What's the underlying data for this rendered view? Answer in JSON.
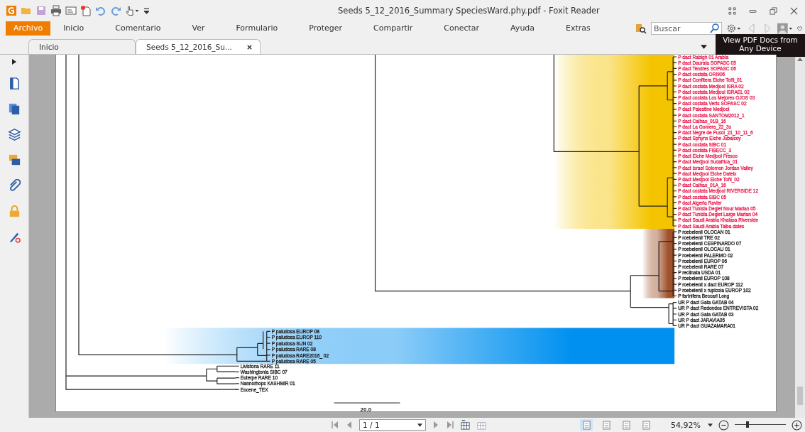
{
  "window": {
    "title": "Seeds 5_12_2016_Summary SpeciesWard.phy.pdf - Foxit Reader"
  },
  "menu": [
    {
      "label": "Archivo",
      "kind": "file"
    },
    {
      "label": "Inicio",
      "kind": "ribbon"
    },
    {
      "label": "Comentario",
      "kind": "ribbon"
    },
    {
      "label": "Ver",
      "kind": "ribbon"
    },
    {
      "label": "Formulario",
      "kind": "ribbon"
    },
    {
      "label": "Proteger",
      "kind": "ribbon"
    },
    {
      "label": "Compartir",
      "kind": "ribbon"
    },
    {
      "label": "Conectar",
      "kind": "ribbon"
    },
    {
      "label": "Ayuda",
      "kind": "ribbon"
    },
    {
      "label": "Extras",
      "kind": "ribbon"
    }
  ],
  "search": {
    "placeholder": "Buscar"
  },
  "promo": {
    "text": "View PDF Docs from Any Device"
  },
  "tabs": [
    {
      "label": "Inicio",
      "selected": false,
      "closable": false
    },
    {
      "label": "Seeds 5_12_2016_Su...",
      "selected": true,
      "closable": true
    }
  ],
  "tree": {
    "groups": [
      {
        "color": "#e8174a",
        "highlight": {
          "color": "#f5c400"
        },
        "taxa": [
          "P dact Rabigh 01 Arabia",
          "P dact Daurata SOPASC 05",
          "P dact Tendres SOPASC 06",
          "P dact costata ORI906",
          "P dact Confitera Elche Toñi_01",
          "P dact costata Medjool ISRA 02",
          "P dact costata Medjoul ISRAEL 02",
          "P dact costata Los Mejores OJOS 03",
          "P dact costata Verts SOPASC 02",
          "P dact Palestine Medjool",
          "P dact costata SANTOM2012_1",
          "P dact Calhao_01B_16",
          "P dact La Gomera_22_3s",
          "P dact Negre de Pusol_21_10_11_6",
          "P dact Sphynx Elche Jubalcoy",
          "P dact costata SIBC 01",
          "P dact costata FIBECC_3",
          "P dact Elche Medjool Fresco",
          "P dact Medjool Sudafrica_01",
          "P dact Israel Solomon Jordan Valley",
          "P dact Medjool Elche Datelx",
          "P dact Medjool Elche Toñi_02",
          "P dact Calhao_01A_16",
          "P dact costata Medjool RIVERSIDE 12",
          "P dact costata SIBC 05",
          "P dact Algeria Ravier",
          "P dact Tunisia Deglet Nour Marian 05",
          "P dact Tunisia Deglet Large Marian 04",
          "P dact Saudi Arabia Khalasa Riverside",
          "P dact Saudi Arabia Taiba dates"
        ]
      },
      {
        "color": "#1a1a1a",
        "highlight": {
          "color": "#a0522d"
        },
        "taxa": [
          "P roebelenii OLOCAN 01",
          "P roebelenii TRE 02",
          "P roebelenii CESPINARDO 07",
          "P roebelenii OLOCAU 01",
          "P roebelenii PALERMO 02",
          "P roebelenii EUROP 06",
          "P roebelenii RARE 07",
          "P reclinata USDA 01",
          "P roebelenii EUROP 108",
          "P roebelenii x dact EUROP 112",
          "P roebelenii x rupicola EUROP 102",
          "P farinifera Beccari Long"
        ]
      },
      {
        "color": "#1a1a1a",
        "taxa": [
          "UR P dact Gata GATAB 04",
          "UR P dact Redondos ENTREVISTA 02",
          "UR P dact Gata GATAB 03",
          "UR P dact JARAVIA05",
          "UR P dact GUAZAMARA01"
        ]
      },
      {
        "color": "#1a1a1a",
        "highlight": {
          "color": "#0090f0"
        },
        "taxa": [
          "P paludosa EUROP 08",
          "P paludosa EUROP 110",
          "P paludosa SUN 02",
          "P paludosa RARE 08",
          "P paludosa RARE2016_ 02",
          "P paludosa RARE 05"
        ]
      },
      {
        "color": "#1a1a1a",
        "taxa": [
          "Livistona RARE 11",
          "Washingtonia SIBC 07",
          "Euterpe RARE 10",
          "Nannorhops KASHMIR 01",
          "Eocene_TEX"
        ]
      }
    ],
    "scale_label": "20.0"
  },
  "status_bar": {
    "page": "1 / 1",
    "zoom": "54,92%",
    "zoom_slider": {
      "level": 0.25
    },
    "view_modes": [
      {
        "selected": true
      },
      {
        "selected": false
      },
      {
        "selected": false
      },
      {
        "selected": false
      }
    ]
  }
}
